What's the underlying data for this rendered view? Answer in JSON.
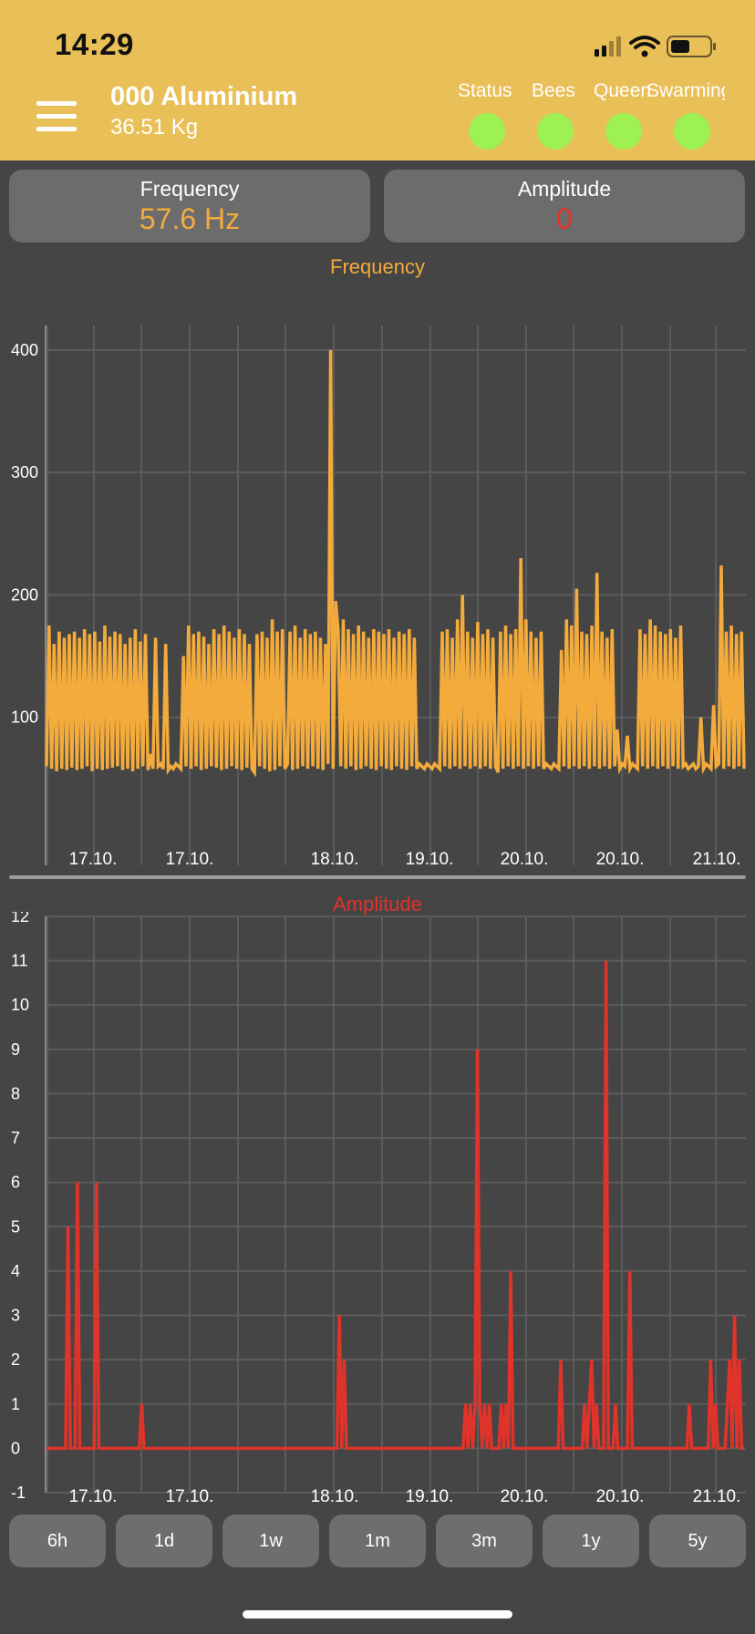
{
  "status_bar": {
    "time": "14:29"
  },
  "header": {
    "hive_name": "000 Aluminium",
    "weight": "36.51 Kg",
    "indicators": [
      {
        "label": "Status",
        "color": "#9ef152"
      },
      {
        "label": "Bees",
        "color": "#9ef152"
      },
      {
        "label": "Queen",
        "color": "#9ef152"
      },
      {
        "label": "Swarming",
        "color": "#9ef152"
      }
    ]
  },
  "cards": {
    "frequency": {
      "label": "Frequency",
      "value": "57.6 Hz"
    },
    "amplitude": {
      "label": "Amplitude",
      "value": "0"
    }
  },
  "colors": {
    "accent": "#f3ab3c",
    "amplitude": "#e0332a",
    "header": "#e9bf57",
    "background": "#454545"
  },
  "chart_data": [
    {
      "type": "line",
      "title": "Frequency",
      "ylim": [
        0,
        420
      ],
      "yticks": [
        100,
        200,
        300,
        400
      ],
      "xticks": [
        "17.10.",
        "17.10.",
        "18.10.",
        "19.10.",
        "20.10.",
        "20.10.",
        "21.10."
      ],
      "grid": true,
      "series": [
        {
          "color": "#f3ab3c",
          "values": [
            60,
            175,
            58,
            160,
            56,
            170,
            58,
            165,
            57,
            168,
            59,
            170,
            57,
            165,
            58,
            172,
            60,
            168,
            56,
            170,
            58,
            162,
            57,
            175,
            58,
            166,
            59,
            170,
            60,
            168,
            57,
            160,
            58,
            165,
            56,
            172,
            58,
            162,
            60,
            168,
            57,
            70,
            58,
            165,
            60,
            62,
            58,
            160,
            57,
            60,
            58,
            62,
            60,
            58,
            150,
            60,
            175,
            58,
            168,
            60,
            170,
            57,
            166,
            58,
            160,
            60,
            172,
            59,
            168,
            57,
            175,
            58,
            170,
            60,
            165,
            58,
            172,
            57,
            168,
            59,
            160,
            58,
            55,
            168,
            60,
            170,
            58,
            165,
            56,
            180,
            57,
            170,
            60,
            172,
            58,
            62,
            170,
            57,
            175,
            58,
            165,
            60,
            172,
            58,
            168,
            60,
            170,
            58,
            165,
            57,
            160,
            62,
            400,
            58,
            195,
            170,
            60,
            180,
            58,
            172,
            60,
            168,
            57,
            175,
            58,
            170,
            60,
            165,
            58,
            172,
            57,
            170,
            60,
            168,
            58,
            172,
            57,
            165,
            60,
            170,
            58,
            168,
            57,
            172,
            60,
            165,
            58,
            62,
            60,
            58,
            62,
            60,
            58,
            62,
            60,
            58,
            170,
            60,
            172,
            58,
            165,
            60,
            180,
            58,
            200,
            60,
            170,
            58,
            165,
            60,
            178,
            58,
            168,
            60,
            172,
            58,
            165,
            60,
            55,
            170,
            58,
            175,
            60,
            168,
            58,
            172,
            60,
            230,
            58,
            180,
            60,
            170,
            58,
            165,
            60,
            170,
            58,
            62,
            60,
            58,
            62,
            60,
            58,
            155,
            60,
            180,
            58,
            175,
            60,
            205,
            58,
            170,
            60,
            168,
            58,
            175,
            60,
            218,
            58,
            170,
            60,
            165,
            58,
            172,
            60,
            90,
            58,
            62,
            60,
            85,
            58,
            62,
            60,
            58,
            172,
            60,
            168,
            58,
            180,
            60,
            175,
            58,
            170,
            60,
            168,
            58,
            172,
            60,
            165,
            58,
            175,
            60,
            62,
            58,
            60,
            62,
            58,
            60,
            100,
            58,
            62,
            60,
            58,
            110,
            60,
            62,
            224,
            58,
            170,
            60,
            175,
            58,
            168,
            60,
            170,
            58
          ]
        }
      ]
    },
    {
      "type": "line",
      "title": "Amplitude",
      "ylim": [
        -1,
        12
      ],
      "yticks": [
        -1,
        0,
        1,
        2,
        3,
        4,
        5,
        6,
        7,
        8,
        9,
        10,
        11,
        12
      ],
      "xticks": [
        "17.10.",
        "17.10.",
        "18.10.",
        "19.10.",
        "20.10.",
        "20.10.",
        "21.10."
      ],
      "grid": true,
      "series": [
        {
          "color": "#e0332a",
          "values": [
            0,
            0,
            0,
            0,
            0,
            0,
            0,
            0,
            0,
            5,
            0,
            0,
            0,
            6,
            0,
            0,
            0,
            0,
            0,
            0,
            0,
            6,
            0,
            0,
            0,
            0,
            0,
            0,
            0,
            0,
            0,
            0,
            0,
            0,
            0,
            0,
            0,
            0,
            0,
            0,
            1,
            0,
            0,
            0,
            0,
            0,
            0,
            0,
            0,
            0,
            0,
            0,
            0,
            0,
            0,
            0,
            0,
            0,
            0,
            0,
            0,
            0,
            0,
            0,
            0,
            0,
            0,
            0,
            0,
            0,
            0,
            0,
            0,
            0,
            0,
            0,
            0,
            0,
            0,
            0,
            0,
            0,
            0,
            0,
            0,
            0,
            0,
            0,
            0,
            0,
            0,
            0,
            0,
            0,
            0,
            0,
            0,
            0,
            0,
            0,
            0,
            0,
            0,
            0,
            0,
            0,
            0,
            0,
            0,
            0,
            0,
            0,
            0,
            0,
            0,
            0,
            0,
            0,
            0,
            0,
            0,
            0,
            0,
            3,
            0,
            2,
            0,
            0,
            0,
            0,
            0,
            0,
            0,
            0,
            0,
            0,
            0,
            0,
            0,
            0,
            0,
            0,
            0,
            0,
            0,
            0,
            0,
            0,
            0,
            0,
            0,
            0,
            0,
            0,
            0,
            0,
            0,
            0,
            0,
            0,
            0,
            0,
            0,
            0,
            0,
            0,
            0,
            0,
            0,
            0,
            0,
            0,
            0,
            0,
            0,
            0,
            1,
            0,
            1,
            0,
            1,
            9,
            1,
            0,
            1,
            0,
            1,
            0,
            0,
            0,
            0,
            1,
            0,
            1,
            0,
            4,
            0,
            0,
            0,
            0,
            0,
            0,
            0,
            0,
            0,
            0,
            0,
            0,
            0,
            0,
            0,
            0,
            0,
            0,
            0,
            0,
            2,
            0,
            0,
            0,
            0,
            0,
            0,
            0,
            0,
            0,
            1,
            0,
            1,
            2,
            0,
            1,
            0,
            0,
            0,
            11,
            0,
            0,
            0,
            1,
            0,
            0,
            0,
            0,
            0,
            4,
            0,
            0,
            0,
            0,
            0,
            0,
            0,
            0,
            0,
            0,
            0,
            0,
            0,
            0,
            0,
            0,
            0,
            0,
            0,
            0,
            0,
            0,
            0,
            0,
            1,
            0,
            0,
            0,
            0,
            0,
            0,
            0,
            0,
            2,
            0,
            1,
            0,
            0,
            0,
            0,
            1,
            2,
            0,
            3,
            0,
            2,
            0,
            0
          ]
        }
      ]
    }
  ],
  "range_buttons": [
    "6h",
    "1d",
    "1w",
    "1m",
    "3m",
    "1y",
    "5y"
  ]
}
